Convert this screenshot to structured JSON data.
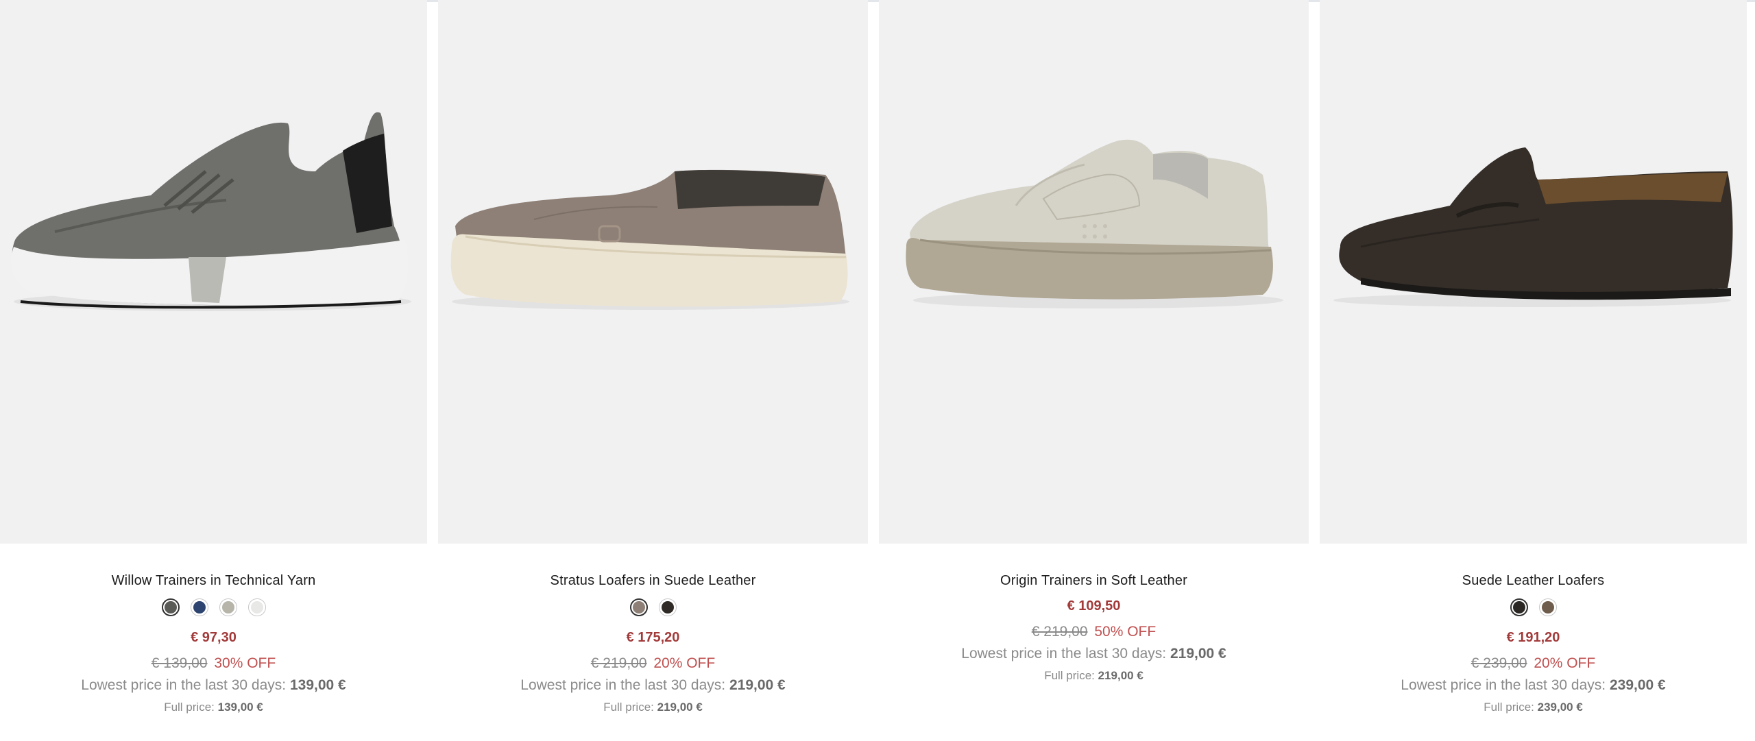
{
  "products": [
    {
      "name": "Willow Trainers in Technical Yarn",
      "swatches": [
        {
          "color": "#5a5a56",
          "selected": true
        },
        {
          "color": "#2e4470",
          "selected": false
        },
        {
          "color": "#b7b5aa",
          "selected": false
        },
        {
          "color": "#e8e8e6",
          "selected": false
        }
      ],
      "price": "€ 97,30",
      "old_price": "€ 139,00",
      "discount": "30% OFF",
      "lowest_label": "Lowest price in the last 30 days:",
      "lowest_value": "139,00 €",
      "full_label": "Full price:",
      "full_value": "139,00 €",
      "image_icon": "grey-knit-trainer-image"
    },
    {
      "name": "Stratus Loafers in Suede Leather",
      "swatches": [
        {
          "color": "#8e8076",
          "selected": true
        },
        {
          "color": "#2f2a25",
          "selected": false
        }
      ],
      "price": "€ 175,20",
      "old_price": "€ 219,00",
      "discount": "20% OFF",
      "lowest_label": "Lowest price in the last 30 days:",
      "lowest_value": "219,00 €",
      "full_label": "Full price:",
      "full_value": "219,00 €",
      "image_icon": "taupe-suede-loafer-image"
    },
    {
      "name": "Origin Trainers in Soft Leather",
      "swatches": [],
      "price": "€ 109,50",
      "old_price": "€ 219,00",
      "discount": "50% OFF",
      "lowest_label": "Lowest price in the last 30 days:",
      "lowest_value": "219,00 €",
      "full_label": "Full price:",
      "full_value": "219,00 €",
      "image_icon": "cream-leather-trainer-image"
    },
    {
      "name": "Suede Leather Loafers",
      "swatches": [
        {
          "color": "#2a2724",
          "selected": true
        },
        {
          "color": "#6e5d4c",
          "selected": false
        }
      ],
      "price": "€ 191,20",
      "old_price": "€ 239,00",
      "discount": "20% OFF",
      "lowest_label": "Lowest price in the last 30 days:",
      "lowest_value": "239,00 €",
      "full_label": "Full price:",
      "full_value": "239,00 €",
      "image_icon": "dark-brown-suede-penny-loafer-image"
    }
  ],
  "colors": {
    "image_bg": "#f1f1f2",
    "sale_price": "#a23a3a",
    "discount_text": "#c05050",
    "muted_text": "#8a8a8a"
  }
}
